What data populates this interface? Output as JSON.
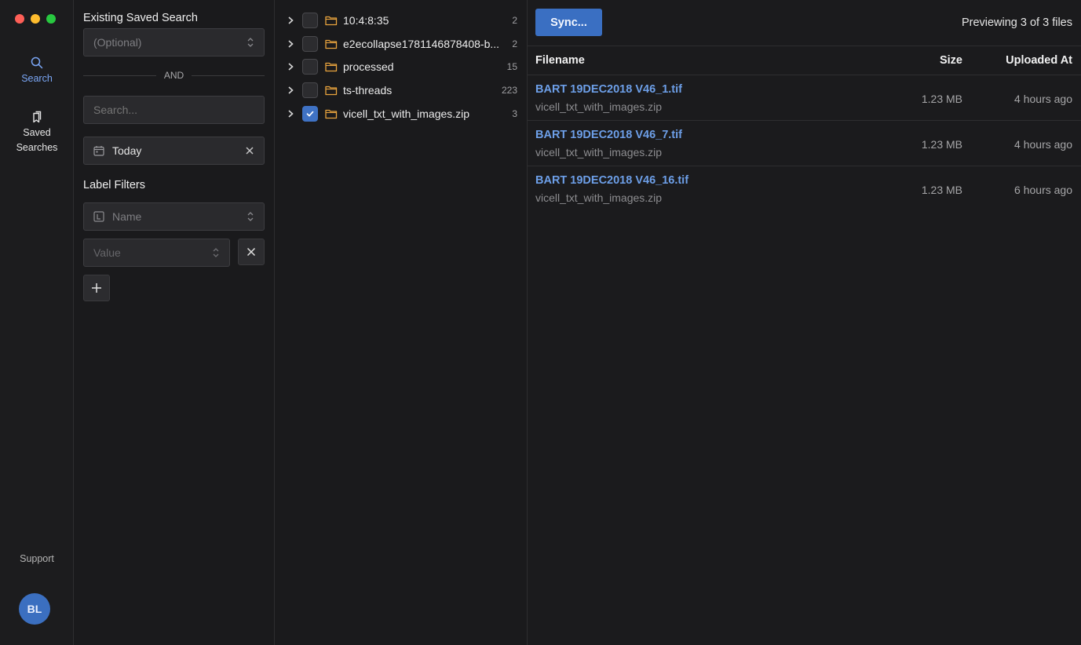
{
  "nav": {
    "search_label": "Search",
    "saved_label_line1": "Saved",
    "saved_label_line2": "Searches",
    "support_label": "Support",
    "avatar_initials": "BL"
  },
  "filters": {
    "saved_search_title": "Existing Saved Search",
    "saved_search_placeholder": "(Optional)",
    "divider_text": "AND",
    "search_placeholder": "Search...",
    "date_value": "Today",
    "label_filters_title": "Label Filters",
    "label_name_placeholder": "Name",
    "label_value_placeholder": "Value"
  },
  "tree": {
    "items": [
      {
        "name": "10:4:8:35",
        "count": "2",
        "checked": false
      },
      {
        "name": "e2ecollapse1781146878408-b...",
        "count": "2",
        "checked": false
      },
      {
        "name": "processed",
        "count": "15",
        "checked": false
      },
      {
        "name": "ts-threads",
        "count": "223",
        "checked": false
      },
      {
        "name": "vicell_txt_with_images.zip",
        "count": "3",
        "checked": true
      }
    ]
  },
  "main": {
    "sync_label": "Sync...",
    "preview_text": "Previewing 3 of 3 files",
    "columns": {
      "filename": "Filename",
      "size": "Size",
      "uploaded": "Uploaded At"
    },
    "files": [
      {
        "name": "BART 19DEC2018 V46_1.tif",
        "source": "vicell_txt_with_images.zip",
        "size": "1.23 MB",
        "uploaded": "4 hours ago"
      },
      {
        "name": "BART 19DEC2018 V46_7.tif",
        "source": "vicell_txt_with_images.zip",
        "size": "1.23 MB",
        "uploaded": "4 hours ago"
      },
      {
        "name": "BART 19DEC2018 V46_16.tif",
        "source": "vicell_txt_with_images.zip",
        "size": "1.23 MB",
        "uploaded": "6 hours ago"
      }
    ]
  },
  "colors": {
    "accent": "#3a6fc2",
    "link": "#6d9fe8",
    "folder": "#e8a33d",
    "background": "#1a1a1c"
  },
  "icons": [
    "search-icon",
    "bookmark-icon",
    "calendar-icon",
    "close-icon",
    "label-icon",
    "plus-icon",
    "chevron-right-icon",
    "folder-icon",
    "check-icon",
    "updown-icon"
  ]
}
